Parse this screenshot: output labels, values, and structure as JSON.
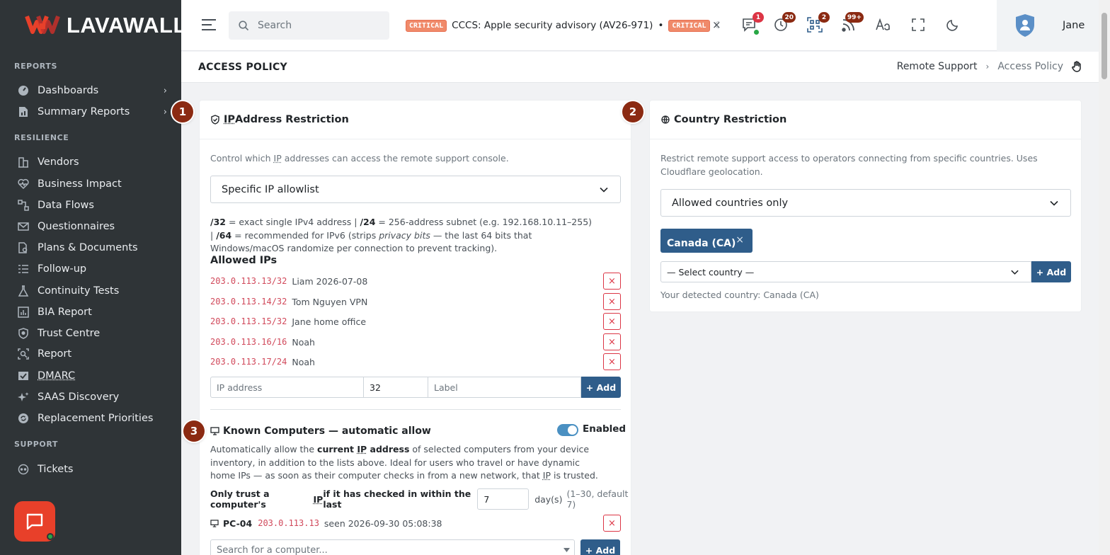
{
  "brand": {
    "name": "LAVAWALL",
    "mark": "®"
  },
  "sidebar": {
    "sections": {
      "reports": "REPORTS",
      "resilience": "RESILIENCE",
      "support": "SUPPORT"
    },
    "items": {
      "dashboards": "Dashboards",
      "summary_reports": "Summary Reports",
      "vendors": "Vendors",
      "business_impact": "Business Impact",
      "data_flows": "Data Flows",
      "questionnaires": "Questionnaires",
      "plans_documents": "Plans & Documents",
      "follow_up": "Follow-up",
      "continuity_tests": "Continuity Tests",
      "bia_report": "BIA Report",
      "trust_centre": "Trust Centre",
      "report": "Report",
      "dmarc": "DMARC",
      "saas_discovery": "SAAS Discovery",
      "replacement_priorities": "Replacement Priorities",
      "tickets": "Tickets"
    }
  },
  "header": {
    "search_placeholder": "Search",
    "ticker": {
      "badge": "CRITICAL",
      "text": "CCCS: Apple security advisory (AV26-971)",
      "bullet": "•",
      "badge2": "CRITICAL",
      "fade": "C",
      "close": "×"
    },
    "badges": {
      "messages": "1",
      "timer": "20",
      "qr": "2",
      "feed": "99+"
    },
    "colors": {
      "badge_red": "#dc3545",
      "badge_brown": "#8b2a12"
    },
    "user": "Jane"
  },
  "page": {
    "title": "ACCESS POLICY",
    "breadcrumb": {
      "parent": "Remote Support",
      "sep": "›",
      "current": "Access Policy"
    }
  },
  "ip_card": {
    "marker": "1",
    "title_abbr": "IP",
    "title_rest": " Address Restriction",
    "desc_a": "Control which ",
    "desc_abbr": "IP",
    "desc_b": " addresses can access the remote support console.",
    "mode": "Specific IP allowlist",
    "help": {
      "b1": "/32",
      "t1": " = exact single IPv4 address  |  ",
      "b2": "/24",
      "t2": " = 256-address subnet (e.g. 192.168.10.11–255)  |  ",
      "b3": "/64",
      "t3": " = recommended for IPv6 (strips ",
      "i1": "privacy bits",
      "t4": " — the last 64 bits that Windows/macOS randomize per connection to prevent tracking)."
    },
    "allowed_label": "Allowed IPs",
    "allowed": [
      {
        "ip": "203.0.113.13/32",
        "label": "Liam 2026-07-08"
      },
      {
        "ip": "203.0.113.14/32",
        "label": "Tom Nguyen VPN"
      },
      {
        "ip": "203.0.113.15/32",
        "label": "Jane home office"
      },
      {
        "ip": "203.0.113.16/16",
        "label": "Noah"
      },
      {
        "ip": "203.0.113.17/24",
        "label": "Noah"
      }
    ],
    "remove_glyph": "×",
    "new_ip_placeholder": "IP address",
    "new_prefix": "32",
    "new_label_placeholder": "Label",
    "add_label": "+ Add"
  },
  "known": {
    "marker": "3",
    "title": "Known Computers — automatic allow",
    "toggle_label": "Enabled",
    "desc": {
      "a": "Automatically allow the ",
      "b": "current ",
      "abbr1": "IP",
      "c": " address",
      "d": " of selected computers from your device inventory, in addition to the lists above. Ideal for users who travel or have dynamic home IPs — as soon as their computer checks in from a new network, that ",
      "abbr2": "IP",
      "e": " is trusted."
    },
    "trust_a": "Only trust a computer's ",
    "trust_abbr": "IP",
    "trust_b": " if it has checked in within the last",
    "trust_days": "7",
    "trust_unit": "day(s)",
    "trust_hint": "(1–30, default 7)",
    "computer": {
      "name": "PC-04",
      "ip": "203.0.113.13",
      "seen": "seen 2026-09-30 05:08:38"
    },
    "search_placeholder": "Search for a computer...",
    "add_label": "+ Add"
  },
  "country_card": {
    "marker": "2",
    "title": "Country Restriction",
    "desc": "Restrict remote support access to operators connecting from specific countries. Uses Cloudflare geolocation.",
    "mode": "Allowed countries only",
    "chip": "Canada (CA)",
    "chip_close": "×",
    "select_placeholder": "— Select country —",
    "add_label": "+ Add",
    "detected": "Your detected country: Canada (CA)"
  }
}
